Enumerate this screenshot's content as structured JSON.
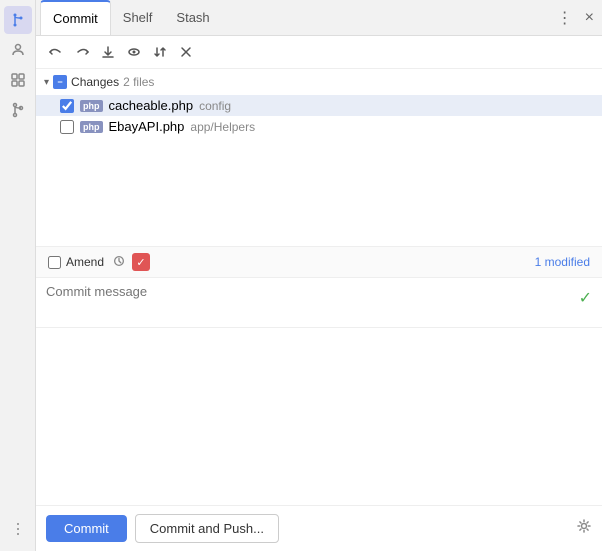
{
  "sidebar": {
    "icons": [
      {
        "name": "git-icon",
        "label": "Git",
        "active": true,
        "symbol": "◈"
      },
      {
        "name": "user-icon",
        "label": "User",
        "active": false,
        "symbol": "👤"
      },
      {
        "name": "modules-icon",
        "label": "Modules",
        "active": false,
        "symbol": "⊞"
      },
      {
        "name": "branches-icon",
        "label": "Branches",
        "active": false,
        "symbol": "⑂"
      },
      {
        "name": "more-icon",
        "label": "More",
        "active": false,
        "symbol": "···"
      }
    ]
  },
  "tabs": [
    {
      "id": "commit",
      "label": "Commit",
      "active": true
    },
    {
      "id": "shelf",
      "label": "Shelf",
      "active": false
    },
    {
      "id": "stash",
      "label": "Stash",
      "active": false
    }
  ],
  "tab_bar_actions": {
    "dots": "⋮",
    "close": "×"
  },
  "toolbar": {
    "undo_label": "↺",
    "redo_label": "↻",
    "download_label": "⬇",
    "eye_label": "👁",
    "arrows_label": "⇅",
    "close_label": "✕"
  },
  "changes": {
    "header_label": "Changes",
    "count_label": "2 files",
    "files": [
      {
        "id": "cacheable",
        "checked": true,
        "type_badge": "php",
        "file_name": "cacheable.php",
        "file_path": "config",
        "selected": true
      },
      {
        "id": "ebayapi",
        "checked": false,
        "type_badge": "php",
        "file_name": "EbayAPI.php",
        "file_path": "app/Helpers",
        "selected": false
      }
    ]
  },
  "bottom_bar": {
    "amend_label": "Amend",
    "modified_label": "1 modified"
  },
  "commit_message": {
    "placeholder": "Commit message"
  },
  "footer": {
    "commit_label": "Commit",
    "commit_push_label": "Commit and Push..."
  }
}
